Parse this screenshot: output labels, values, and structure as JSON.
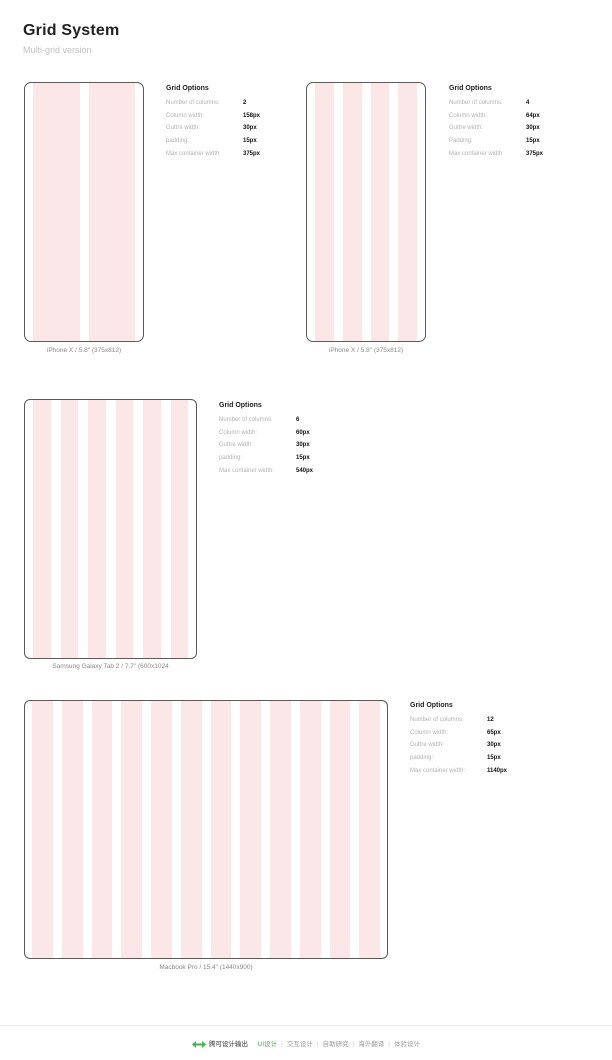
{
  "header": {
    "title": "Grid System",
    "subtitle": "Multi-grid version"
  },
  "colors": {
    "column": "#fbe6e8",
    "border": "#5a5a5a",
    "accent": "#45b649"
  },
  "devices": [
    {
      "caption": "iPhone X / 5.8\" (375x812)",
      "options_title": "Grid Options",
      "options": [
        {
          "label": "Number of columns:",
          "value": "2"
        },
        {
          "label": "Column width:",
          "value": "158px"
        },
        {
          "label": "Guttre width:",
          "value": "30px"
        },
        {
          "label": "padding:",
          "value": "15px"
        },
        {
          "label": "Max container width",
          "value": "375px"
        }
      ]
    },
    {
      "caption": "iPhone X / 5.8\" (375x812)",
      "options_title": "Grid Options",
      "options": [
        {
          "label": "Number of columns:",
          "value": "4"
        },
        {
          "label": "Column width:",
          "value": "64px"
        },
        {
          "label": "Guttre width:",
          "value": "30px"
        },
        {
          "label": "Padding:",
          "value": "15px"
        },
        {
          "label": "Max container width",
          "value": "375px"
        }
      ]
    },
    {
      "caption": "Samsung Galaxy Tab 2 / 7.7\" (600x1024",
      "options_title": "Grid Options",
      "options": [
        {
          "label": "Number of columns:",
          "value": "6"
        },
        {
          "label": "Column width:",
          "value": "60px"
        },
        {
          "label": "Guttre width:",
          "value": "30px"
        },
        {
          "label": "padding:",
          "value": "15px"
        },
        {
          "label": "Max container width:",
          "value": "540px"
        }
      ]
    },
    {
      "caption": "Macbook Pro / 15.4\" (1440x900)",
      "options_title": "Grid Options",
      "options": [
        {
          "label": "Number of columns:",
          "value": "12"
        },
        {
          "label": "Column width:",
          "value": "65px"
        },
        {
          "label": "Guttre width:",
          "value": "30px"
        },
        {
          "label": "padding:",
          "value": "15px"
        },
        {
          "label": "Max container width:",
          "value": "1140px"
        }
      ]
    }
  ],
  "footer": {
    "logo": "double-arrow-logo-icon",
    "brand": "腾可设计输出",
    "items": [
      "UI设计",
      "交互设计",
      "自助研究",
      "海外翻译",
      "体验设计"
    ]
  }
}
